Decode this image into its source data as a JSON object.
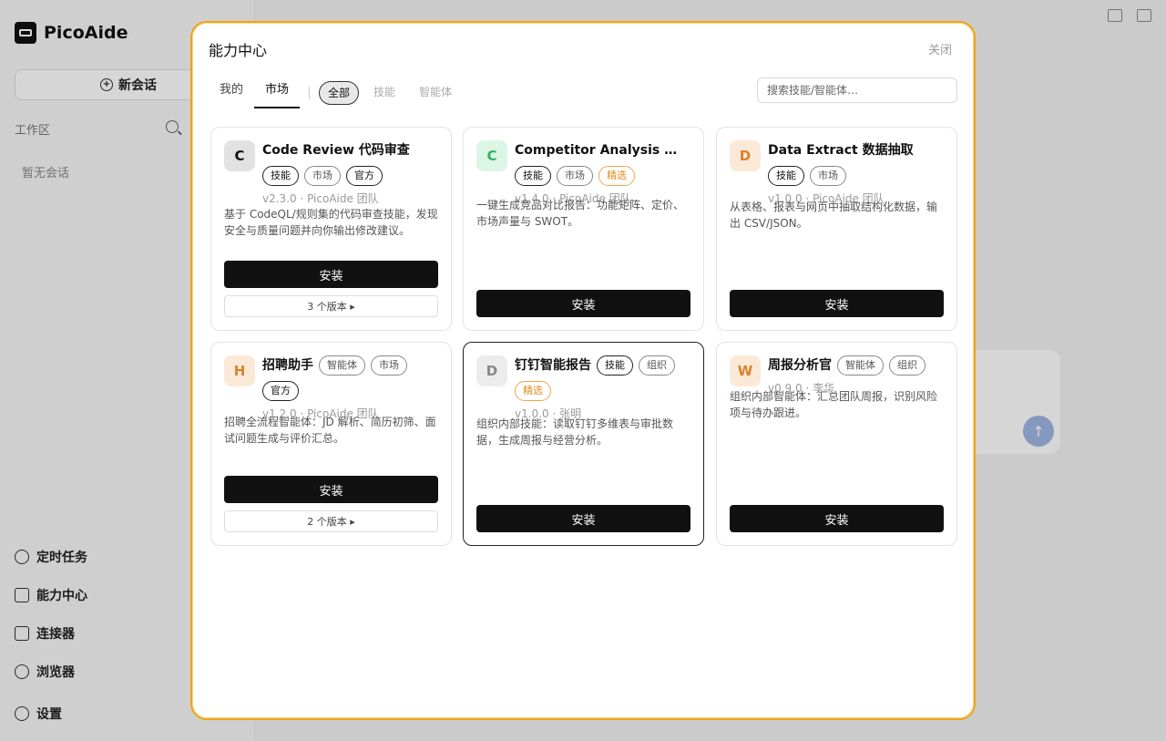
{
  "app": {
    "name": "PicoAide",
    "new_chat": "新会话",
    "workspace": "工作区",
    "empty": "暂无会话",
    "nav": [
      "定时任务",
      "能力中心",
      "连接器",
      "浏览器",
      "设置"
    ]
  },
  "modal": {
    "title": "能力中心",
    "close": "关闭",
    "tabs": [
      "我的",
      "市场"
    ],
    "filters": [
      "全部",
      "技能",
      "智能体"
    ],
    "search_placeholder": "搜索技能/智能体…"
  },
  "cards": [
    {
      "letter": "C",
      "avatar_bg": "#e2e2e2",
      "avatar_fg": "#111111",
      "name": "Code Review 代码审查",
      "tags": [
        {
          "t": "技能",
          "s": "dark"
        },
        {
          "t": "市场",
          "s": "plain"
        },
        {
          "t": "官方",
          "s": "dark"
        }
      ],
      "meta": "v2.3.0 · PicoAide 团队",
      "desc": "基于 CodeQL/规则集的代码审查技能，发现安全与质量问题并向你输出修改建议。",
      "install": "安装",
      "versions": "3 个版本 ▸"
    },
    {
      "letter": "C",
      "avatar_bg": "#ddf5e4",
      "avatar_fg": "#2fb35a",
      "name": "Competitor Analysis 竞品…",
      "tags": [
        {
          "t": "技能",
          "s": "dark"
        },
        {
          "t": "市场",
          "s": "plain"
        },
        {
          "t": "精选",
          "s": "orange"
        }
      ],
      "meta": "v1.4.0 · PicoAide 团队",
      "desc": "一键生成竞品对比报告：功能矩阵、定价、市场声量与 SWOT。",
      "install": "安装"
    },
    {
      "letter": "D",
      "avatar_bg": "#fbe9d8",
      "avatar_fg": "#d9822b",
      "name": "Data Extract 数据抽取",
      "tags": [
        {
          "t": "技能",
          "s": "dark"
        },
        {
          "t": "市场",
          "s": "plain"
        }
      ],
      "meta": "v1.0.0 · PicoAide 团队",
      "desc": "从表格、报表与网页中抽取结构化数据，输出 CSV/JSON。",
      "install": "安装"
    },
    {
      "letter": "H",
      "avatar_bg": "#fbe9d8",
      "avatar_fg": "#d9822b",
      "name": "招聘助手",
      "tags": [
        {
          "t": "智能体",
          "s": "plain"
        },
        {
          "t": "市场",
          "s": "plain"
        },
        {
          "t": "官方",
          "s": "dark"
        }
      ],
      "meta": "v1.2.0 · PicoAide 团队",
      "desc": "招聘全流程智能体：JD 解析、简历初筛、面试问题生成与评价汇总。",
      "install": "安装",
      "versions": "2 个版本 ▸"
    },
    {
      "letter": "D",
      "avatar_bg": "#ececec",
      "avatar_fg": "#888888",
      "name": "钉钉智能报告",
      "tags": [
        {
          "t": "技能",
          "s": "dark"
        },
        {
          "t": "组织",
          "s": "plain"
        },
        {
          "t": "精选",
          "s": "orange"
        }
      ],
      "meta": "v1.0.0 · 张明",
      "desc": "组织内部技能：读取钉钉多维表与审批数据，生成周报与经营分析。",
      "install": "安装"
    },
    {
      "letter": "W",
      "avatar_bg": "#fbe9d8",
      "avatar_fg": "#d9822b",
      "name": "周报分析官",
      "tags": [
        {
          "t": "智能体",
          "s": "plain"
        },
        {
          "t": "组织",
          "s": "plain"
        }
      ],
      "meta": "v0.9.0 · 李华",
      "desc": "组织内部智能体：汇总团队周报，识别风险项与待办跟进。",
      "install": "安装"
    }
  ]
}
